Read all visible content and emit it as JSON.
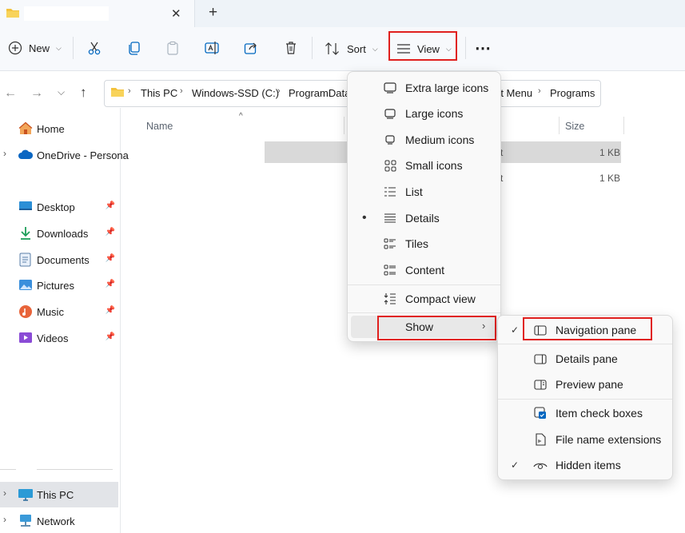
{
  "colors": {
    "accent": "#0067c0",
    "highlight_box": "#e0201e",
    "folder": "#f3c23c"
  },
  "toolbar": {
    "new_label": "New",
    "sort_label": "Sort",
    "view_label": "View",
    "more_label": "⋯"
  },
  "address": {
    "crumbs": [
      "This PC",
      "Windows-SSD (C:)",
      "ProgramData",
      "rt Menu",
      "Programs"
    ]
  },
  "sidebar": {
    "home": "Home",
    "onedrive": "OneDrive - Persona",
    "desktop": "Desktop",
    "downloads": "Downloads",
    "documents": "Documents",
    "pictures": "Pictures",
    "music": "Music",
    "videos": "Videos",
    "this_pc": "This PC",
    "network": "Network"
  },
  "file_list": {
    "col_name": "Name",
    "col_size": "Size",
    "rows": [
      {
        "type_fragment": "t",
        "size": "1 KB"
      },
      {
        "type_fragment": "t",
        "size": "1 KB"
      }
    ]
  },
  "view_menu": {
    "items": [
      {
        "label": "Extra large icons",
        "icon": "extra-large-icons-icon"
      },
      {
        "label": "Large icons",
        "icon": "large-icons-icon"
      },
      {
        "label": "Medium icons",
        "icon": "medium-icons-icon"
      },
      {
        "label": "Small icons",
        "icon": "small-icons-icon"
      },
      {
        "label": "List",
        "icon": "list-icon"
      },
      {
        "label": "Details",
        "icon": "details-icon",
        "selected": true
      },
      {
        "label": "Tiles",
        "icon": "tiles-icon"
      },
      {
        "label": "Content",
        "icon": "content-icon"
      }
    ],
    "compact": "Compact view",
    "show": "Show"
  },
  "show_menu": {
    "items": [
      {
        "label": "Navigation pane",
        "checked": true
      },
      {
        "label": "Details pane",
        "checked": false
      },
      {
        "label": "Preview pane",
        "checked": false
      },
      {
        "label": "Item check boxes",
        "checked": false
      },
      {
        "label": "File name extensions",
        "checked": false
      },
      {
        "label": "Hidden items",
        "checked": true
      }
    ]
  }
}
